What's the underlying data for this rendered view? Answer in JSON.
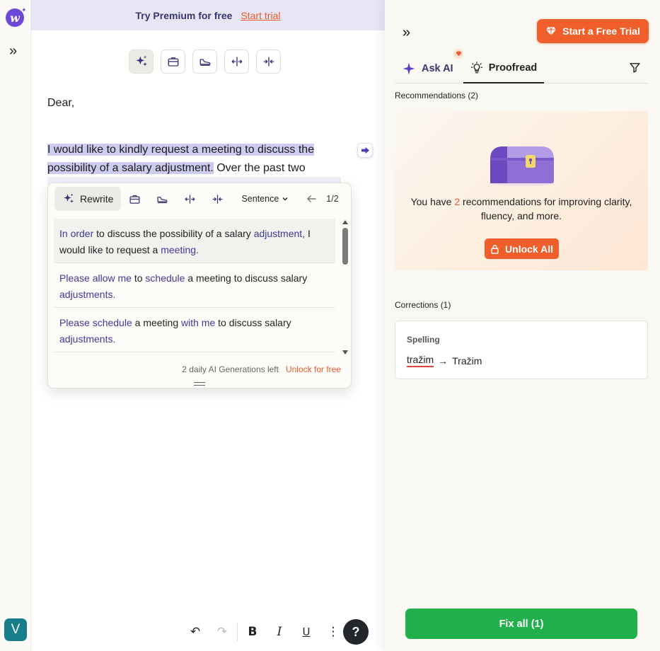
{
  "rail": {
    "logo_letter": "w",
    "avatar_letter": "V"
  },
  "banner": {
    "text": "Try Premium for free",
    "link": "Start trial"
  },
  "doc": {
    "greeting": "Dear,",
    "highlighted": "I would like to kindly request a meeting to discuss the possibility of a salary adjustment.",
    "rest": " Over the past two"
  },
  "rewrite": {
    "button_label": "Rewrite",
    "mode_label": "Sentence",
    "page": "1/2",
    "suggestions": [
      [
        {
          "t": "In order",
          "c": true
        },
        {
          "t": " to discuss the possibility of a salary ",
          "c": false
        },
        {
          "t": "adjustment,",
          "c": true
        },
        {
          "t": " I would like to request a ",
          "c": false
        },
        {
          "t": "meeting.",
          "c": true
        }
      ],
      [
        {
          "t": "Please allow me",
          "c": true
        },
        {
          "t": " to ",
          "c": false
        },
        {
          "t": "schedule",
          "c": true
        },
        {
          "t": " a meeting to discuss salary ",
          "c": false
        },
        {
          "t": "adjustments.",
          "c": true
        }
      ],
      [
        {
          "t": "Please schedule",
          "c": true
        },
        {
          "t": " a meeting ",
          "c": false
        },
        {
          "t": "with me",
          "c": true
        },
        {
          "t": " to discuss salary ",
          "c": false
        },
        {
          "t": "adjustments.",
          "c": true
        }
      ]
    ],
    "daily_left": "2 daily AI Generations left",
    "unlock": "Unlock for free"
  },
  "bottom_toolbar": {
    "undo": "↶",
    "redo": "↷",
    "bold": "B",
    "italic": "I",
    "underline": "U",
    "more": "⋮",
    "help": "?"
  },
  "panel": {
    "trial_button": "Start a Free Trial",
    "tabs": {
      "ask_ai": "Ask AI",
      "proofread": "Proofread"
    },
    "recommendations_label": "Recommendations (2)",
    "rec_text_before": "You have ",
    "rec_count": "2",
    "rec_text_after": " recommendations for improving clarity, fluency, and more.",
    "unlock_all": "Unlock All",
    "corrections_label": "Corrections (1)",
    "correction": {
      "type": "Spelling",
      "original": "tražim",
      "arrow": "→",
      "replacement": "Tražim"
    },
    "fix_all": "Fix all (1)"
  },
  "colors": {
    "brand_purple": "#6d48d7",
    "accent_orange": "#f05f2b",
    "highlight": "#cdcbf0",
    "success_green": "#21b04c",
    "change_text": "#3e3a99"
  },
  "icons": {
    "sparkle": "sparkle-icon",
    "briefcase": "briefcase-icon",
    "sneaker": "sneaker-icon",
    "expand": "expand-arrows-icon",
    "shorten": "shorten-arrows-icon",
    "lightbulb": "lightbulb-icon",
    "filter": "filter-icon",
    "gem": "gem-icon",
    "lock": "lock-icon"
  }
}
